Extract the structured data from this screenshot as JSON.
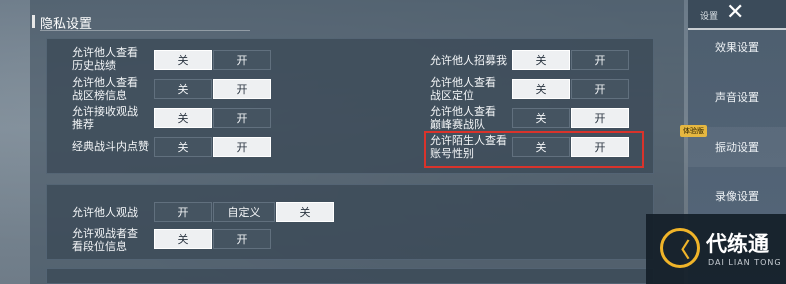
{
  "section": {
    "title": "隐私设置"
  },
  "privacy_left": [
    {
      "label_lines": [
        "允许他人查看",
        "历史战绩"
      ],
      "off": "关",
      "on": "开",
      "selected": "off"
    },
    {
      "label_lines": [
        "允许他人查看",
        "战区榜信息"
      ],
      "off": "关",
      "on": "开",
      "selected": "on"
    },
    {
      "label_lines": [
        "允许接收观战",
        "推荐"
      ],
      "off": "关",
      "on": "开",
      "selected": "off"
    },
    {
      "label_lines": [
        "经典战斗内点赞"
      ],
      "off": "关",
      "on": "开",
      "selected": "on"
    }
  ],
  "privacy_right": [
    {
      "label_lines": [
        "允许他人招募我"
      ],
      "off": "关",
      "on": "开",
      "selected": "off"
    },
    {
      "label_lines": [
        "允许他人查看",
        "战区定位"
      ],
      "off": "关",
      "on": "开",
      "selected": "off"
    },
    {
      "label_lines": [
        "允许他人查看",
        "巅峰赛战队"
      ],
      "off": "关",
      "on": "开",
      "selected": "on"
    },
    {
      "label_lines": [
        "允许陌生人查看",
        "账号性别"
      ],
      "off": "关",
      "on": "开",
      "selected": "on"
    }
  ],
  "spectate": {
    "label": "允许他人观战",
    "options": [
      "开",
      "自定义",
      "关"
    ],
    "selected": "关"
  },
  "spectator_rank": {
    "label_lines": [
      "允许观战者查",
      "看段位信息"
    ],
    "off": "关",
    "on": "开",
    "selected": "off"
  },
  "sidebar": {
    "title": "设置",
    "close_icon": "close-icon",
    "items": [
      "效果设置",
      "声音设置",
      "振动设置",
      "录像设置"
    ],
    "badge": "体验版"
  },
  "watermark": {
    "name": "代练通",
    "sub": "DAI LIAN TONG"
  },
  "colors": {
    "highlight": "#d9332b",
    "toggle_on": "#eef0f2",
    "badge": "#e6b740"
  }
}
